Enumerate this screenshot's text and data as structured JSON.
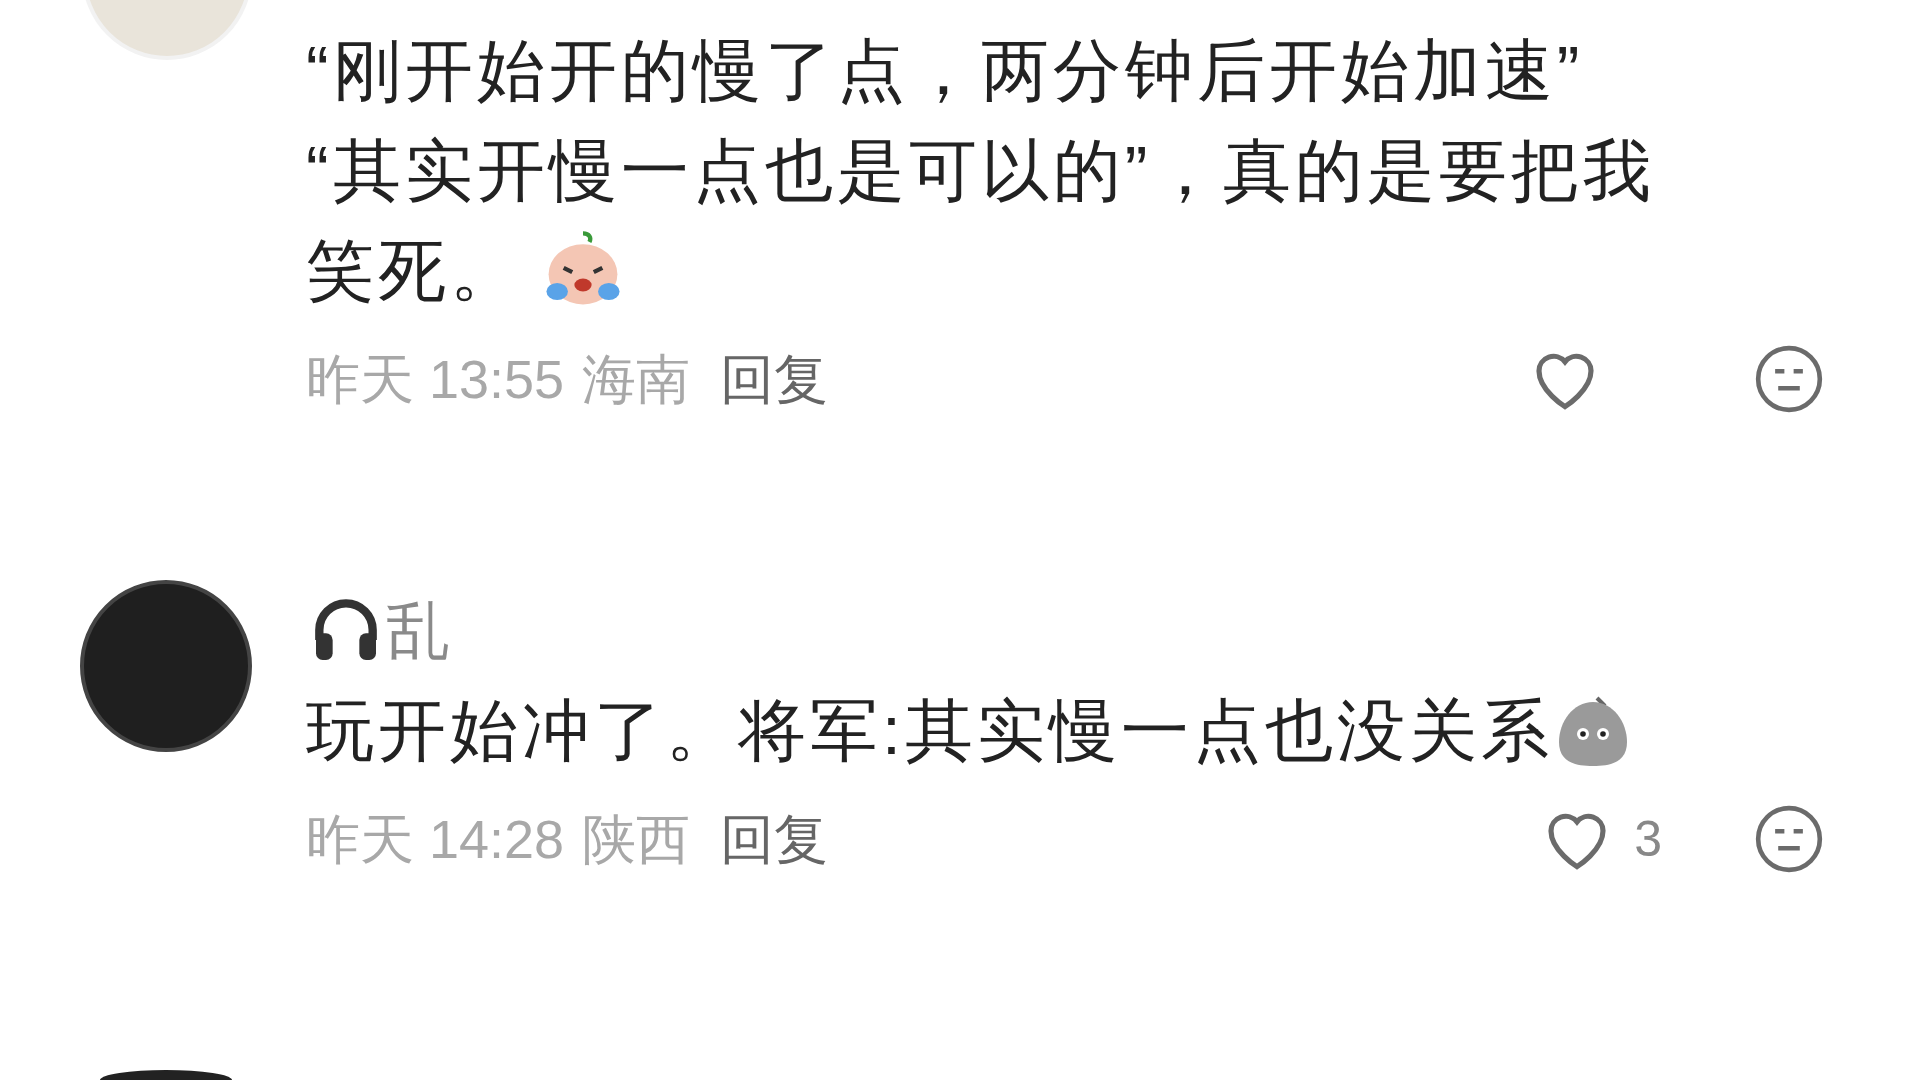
{
  "comments": [
    {
      "text_lines": [
        "“刚开始开的慢了点，两分钟后开始加速”",
        "“其实开慢一点也是可以的”，真的是要把我",
        "笑死。"
      ],
      "time": "昨天 13:55",
      "location": "海南",
      "reply": "回复",
      "liked": false
    },
    {
      "username": "乱",
      "text_lines": [
        "玩开始冲了。将军:其实慢一点也没关系"
      ],
      "time": "昨天 14:28",
      "location": "陕西",
      "reply": "回复",
      "liked": false,
      "likes": "3"
    }
  ]
}
